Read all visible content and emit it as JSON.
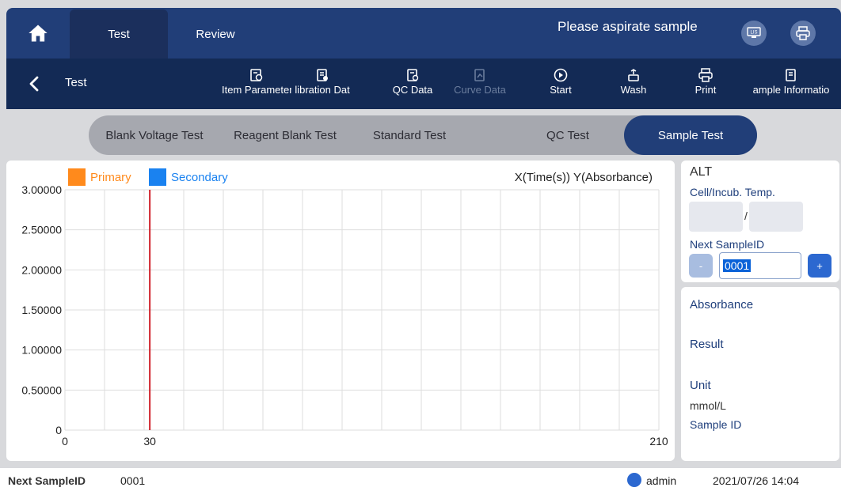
{
  "header": {
    "tabs": [
      {
        "label": "Test"
      },
      {
        "label": "Review"
      }
    ],
    "status_message": "Please aspirate sample",
    "lis_icon_text": "LIS"
  },
  "toolbar": {
    "title": "Test",
    "buttons": [
      {
        "label": "Item Parameter",
        "icon": "item-parameter-icon"
      },
      {
        "label": "libration Dat",
        "icon": "calibration-icon"
      },
      {
        "label": "QC Data",
        "icon": "qc-data-icon"
      },
      {
        "label": "Curve Data",
        "icon": "curve-data-icon",
        "disabled": true
      },
      {
        "label": "Start",
        "icon": "start-icon"
      },
      {
        "label": "Wash",
        "icon": "wash-icon"
      },
      {
        "label": "Print",
        "icon": "print-icon"
      },
      {
        "label": "ample Informatio",
        "icon": "sample-info-icon"
      }
    ]
  },
  "test_types": [
    "Blank Voltage Test",
    "Reagent Blank Test",
    "Standard Test",
    "QC Test",
    "Sample Test"
  ],
  "active_test_type": "Sample Test",
  "chart_data": {
    "type": "line",
    "legend": [
      {
        "name": "Primary",
        "color": "#ff8a1c"
      },
      {
        "name": "Secondary",
        "color": "#1a82f0"
      }
    ],
    "axis_caption": "X(Time(s))  Y(Absorbance)",
    "x_ticks": [
      "0",
      "30",
      "210"
    ],
    "y_ticks": [
      "0",
      "0.50000",
      "1.00000",
      "1.50000",
      "2.00000",
      "2.50000",
      "3.00000"
    ],
    "xlim": [
      0,
      210
    ],
    "ylim": [
      0,
      3.0
    ],
    "vertical_marker_x": 30,
    "marker_color": "#d0202a",
    "grid": true,
    "series": []
  },
  "side": {
    "item_name": "ALT",
    "temp_label": "Cell/Incub. Temp.",
    "temp_separator": "/",
    "next_sample_label": "Next SampleID",
    "next_sample_value": "0001",
    "minus_label": "-",
    "plus_label": "+",
    "absorbance_label": "Absorbance",
    "result_label": "Result",
    "unit_label": "Unit",
    "unit_value": "mmol/L",
    "sample_id_label": "Sample ID"
  },
  "footer": {
    "next_sample_label": "Next SampleID",
    "next_sample_value": "0001",
    "user": "admin",
    "datetime": "2021/07/26 14:04"
  }
}
